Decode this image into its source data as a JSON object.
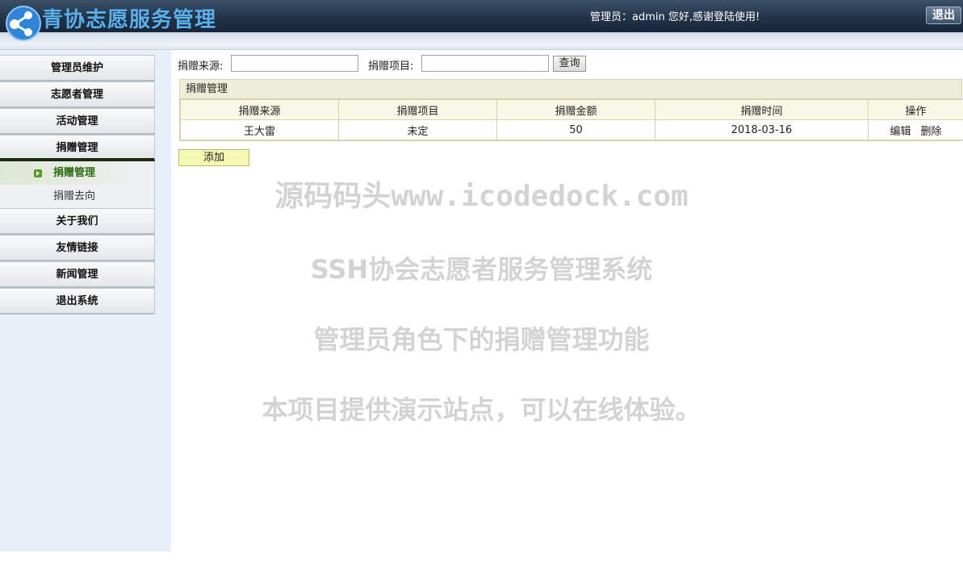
{
  "header": {
    "title": "青协志愿服务管理",
    "welcome": "管理员：admin 您好,感谢登陆使用!",
    "logout_label": "退出"
  },
  "sidebar": {
    "items": [
      {
        "label": "管理员维护"
      },
      {
        "label": "志愿者管理"
      },
      {
        "label": "活动管理"
      },
      {
        "label": "捐赠管理"
      }
    ],
    "submenu": [
      {
        "label": "捐赠管理",
        "active": true
      },
      {
        "label": "捐赠去向",
        "active": false
      }
    ],
    "items_after": [
      {
        "label": "关于我们"
      },
      {
        "label": "友情链接"
      },
      {
        "label": "新闻管理"
      },
      {
        "label": "退出系统"
      }
    ]
  },
  "search": {
    "source_label": "捐赠来源:",
    "source_value": "",
    "item_label": "捐赠项目:",
    "item_value": "",
    "query_label": "查询"
  },
  "grid": {
    "caption": "捐赠管理",
    "columns": [
      "捐赠来源",
      "捐赠项目",
      "捐赠金额",
      "捐赠时间",
      "操作"
    ],
    "rows": [
      {
        "source": "王大雷",
        "item": "未定",
        "amount": "50",
        "date": "2018-03-16",
        "edit": "编辑",
        "delete": "删除"
      }
    ]
  },
  "add_label": "添加",
  "watermark": {
    "line1": "源码码头www.icodedock.com",
    "line2": "SSH协会志愿者服务管理系统",
    "line3": "管理员角色下的捐赠管理功能",
    "line4": "本项目提供演示站点，可以在线体验。"
  }
}
